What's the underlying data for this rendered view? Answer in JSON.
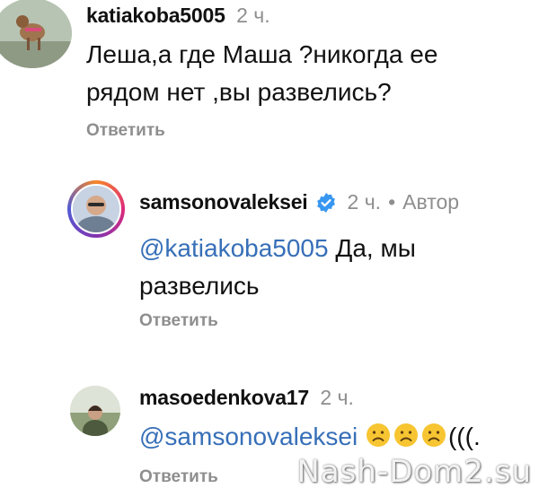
{
  "comments": [
    {
      "username": "katiakoba5005",
      "time": "2 ч.",
      "text": "Леша,а где Маша ?никогда ее рядом нет ,вы развелись?",
      "reply_label": "Ответить"
    },
    {
      "username": "samsonovaleksei",
      "verified": true,
      "time": "2 ч.",
      "separator": "•",
      "author_label": "Автор",
      "mention": "@katiakoba5005",
      "text": " Да, мы развелись",
      "reply_label": "Ответить"
    },
    {
      "username": "masoedenkova17",
      "time": "2 ч.",
      "mention": "@samsonovaleksei",
      "emojis": [
        "sad-face",
        "sad-face",
        "sad-face"
      ],
      "text_suffix": "(((.",
      "reply_label": "Ответить"
    }
  ],
  "watermark": "Nash-Dom2.su",
  "colors": {
    "mention": "#376fb8",
    "meta": "#8e8e8e",
    "verified": "#3897f0"
  }
}
